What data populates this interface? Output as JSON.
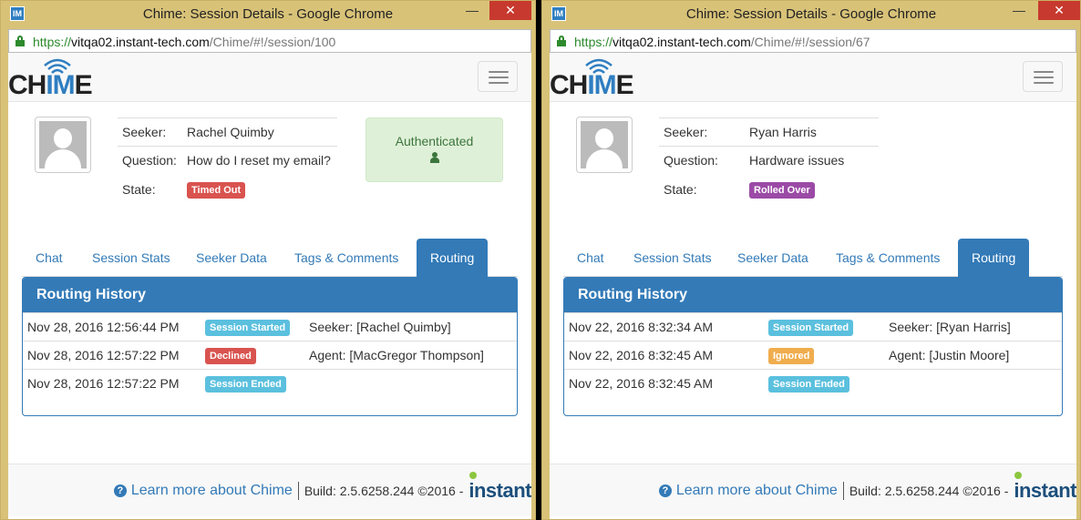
{
  "windows": [
    {
      "title": "Chime: Session Details - Google Chrome",
      "url": {
        "scheme": "https://",
        "host": "vitqa02.instant-tech.com",
        "path": "/Chime/#!/session/100"
      },
      "logo": {
        "text_before": "CH",
        "text_mid": "IM",
        "text_after": "E"
      },
      "seeker": {
        "label": "Seeker:",
        "value": "Rachel Quimby"
      },
      "question": {
        "label": "Question:",
        "value": "How do I reset my email?"
      },
      "state": {
        "label": "State:",
        "value": "Timed Out",
        "color": "#d9534f"
      },
      "auth": {
        "text": "Authenticated",
        "shown": true
      },
      "tabs": [
        "Chat",
        "Session Stats",
        "Seeker Data",
        "Tags & Comments",
        "Routing"
      ],
      "active_tab": "Routing",
      "routing": {
        "heading": "Routing History",
        "rows": [
          {
            "time": "Nov 28, 2016 12:56:44 PM",
            "event": "Session Started",
            "event_color": "#5bc0de",
            "detail": "Seeker: [Rachel Quimby]"
          },
          {
            "time": "Nov 28, 2016 12:57:22 PM",
            "event": "Declined",
            "event_color": "#d9534f",
            "detail": "Agent: [MacGregor Thompson]"
          },
          {
            "time": "Nov 28, 2016 12:57:22 PM",
            "event": "Session Ended",
            "event_color": "#5bc0de",
            "detail": ""
          }
        ]
      },
      "footer": {
        "learn_more": "Learn more about Chime",
        "build": "Build: 2.5.6258.244 ©2016 -",
        "brand": "instant"
      }
    },
    {
      "title": "Chime: Session Details - Google Chrome",
      "url": {
        "scheme": "https://",
        "host": "vitqa02.instant-tech.com",
        "path": "/Chime/#!/session/67"
      },
      "logo": {
        "text_before": "CH",
        "text_mid": "IM",
        "text_after": "E"
      },
      "seeker": {
        "label": "Seeker:",
        "value": "Ryan Harris"
      },
      "question": {
        "label": "Question:",
        "value": "Hardware issues"
      },
      "state": {
        "label": "State:",
        "value": "Rolled Over",
        "color": "#9b4aa6"
      },
      "auth": {
        "text": "",
        "shown": false
      },
      "tabs": [
        "Chat",
        "Session Stats",
        "Seeker Data",
        "Tags & Comments",
        "Routing"
      ],
      "active_tab": "Routing",
      "routing": {
        "heading": "Routing History",
        "rows": [
          {
            "time": "Nov 22, 2016 8:32:34 AM",
            "event": "Session Started",
            "event_color": "#5bc0de",
            "detail": "Seeker: [Ryan Harris]"
          },
          {
            "time": "Nov 22, 2016 8:32:45 AM",
            "event": "Ignored",
            "event_color": "#f0ad4e",
            "detail": "Agent: [Justin Moore]"
          },
          {
            "time": "Nov 22, 2016 8:32:45 AM",
            "event": "Session Ended",
            "event_color": "#5bc0de",
            "detail": ""
          }
        ]
      },
      "footer": {
        "learn_more": "Learn more about Chime",
        "build": "Build: 2.5.6258.244 ©2016 -",
        "brand": "instant"
      }
    }
  ]
}
